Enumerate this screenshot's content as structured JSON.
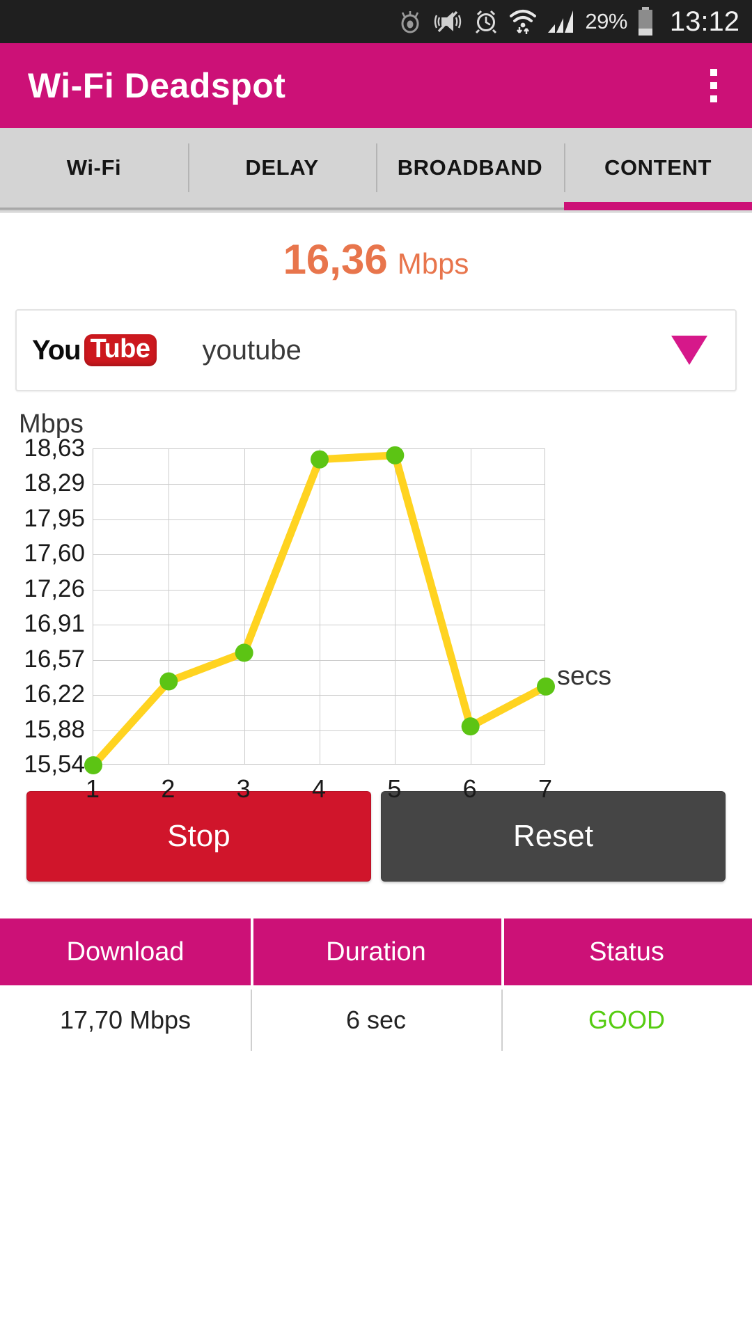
{
  "statusbar": {
    "battery_percent": "29%",
    "clock": "13:12",
    "icons": [
      "eye-icon",
      "vibrate-mute-icon",
      "alarm-clock-icon",
      "wifi-transfer-icon",
      "signal-bars-icon",
      "battery-icon"
    ]
  },
  "actionbar": {
    "title": "Wi-Fi Deadspot",
    "overflow_icon": "overflow-menu-icon"
  },
  "tabs": [
    {
      "label": "Wi-Fi",
      "active": false
    },
    {
      "label": "DELAY",
      "active": false
    },
    {
      "label": "BROADBAND",
      "active": false
    },
    {
      "label": "CONTENT",
      "active": true
    }
  ],
  "speed": {
    "value": "16,36",
    "unit": "Mbps",
    "color": "#e8754c"
  },
  "selector": {
    "logo_you": "You",
    "logo_tube": "Tube",
    "logo_icon": "youtube-logo-icon",
    "label": "youtube",
    "arrow_icon": "chevron-down-icon",
    "arrow_color": "#d6188a"
  },
  "buttons": {
    "stop": "Stop",
    "reset": "Reset",
    "stop_color": "#d0152b",
    "reset_color": "#454545"
  },
  "results": {
    "headers": [
      "Download",
      "Duration",
      "Status"
    ],
    "values": [
      "17,70 Mbps",
      "6 sec",
      "GOOD"
    ],
    "status_color": "#56cc12"
  },
  "chart_data": {
    "type": "line",
    "title": "",
    "xlabel": "secs",
    "ylabel": "Mbps",
    "x": [
      1,
      2,
      3,
      4,
      5,
      6,
      7
    ],
    "categories": [
      "1",
      "2",
      "3",
      "4",
      "5",
      "6",
      "7"
    ],
    "values": [
      15.54,
      16.36,
      16.64,
      18.53,
      18.57,
      15.92,
      16.31
    ],
    "series": [
      {
        "name": "youtube",
        "values": [
          15.54,
          16.36,
          16.64,
          18.53,
          18.57,
          15.92,
          16.31
        ]
      }
    ],
    "ytick_labels": [
      "18,63",
      "18,29",
      "17,95",
      "17,60",
      "17,26",
      "16,91",
      "16,57",
      "16,22",
      "15,88",
      "15,54"
    ],
    "ytick_values": [
      18.63,
      18.29,
      17.95,
      17.6,
      17.26,
      16.91,
      16.57,
      16.22,
      15.88,
      15.54
    ],
    "xtick_labels": [
      "1",
      "2",
      "3",
      "4",
      "5",
      "6",
      "7"
    ],
    "ylim": [
      15.54,
      18.63
    ],
    "xlim": [
      1,
      7
    ],
    "grid": true,
    "legend": "none",
    "line_color": "#ffd320",
    "point_color": "#5cc414"
  }
}
